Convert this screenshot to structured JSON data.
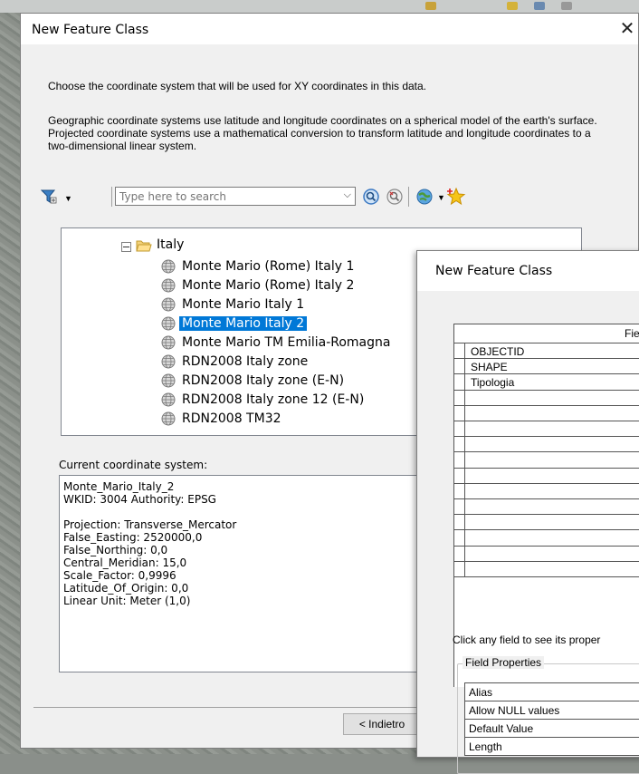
{
  "main_dialog": {
    "title": "New Feature Class",
    "close": "✕",
    "instruction": "Choose the coordinate system that will be used for XY coordinates in this data.",
    "description": "Geographic coordinate systems use latitude and longitude coordinates on a spherical model of the earth's surface. Projected coordinate systems use a mathematical conversion to transform latitude and longitude coordinates to a two-dimensional linear system.",
    "search": {
      "placeholder": "Type here to search"
    },
    "tree": {
      "folder": "Italy",
      "items": [
        "Monte Mario (Rome) Italy 1",
        "Monte Mario (Rome) Italy 2",
        "Monte Mario Italy 1",
        "Monte Mario Italy 2",
        "Monte Mario TM Emilia-Romagna",
        "RDN2008 Italy zone",
        "RDN2008 Italy zone (E-N)",
        "RDN2008 Italy zone 12 (E-N)",
        "RDN2008 TM32"
      ],
      "selected_index": 3
    },
    "current_cs_label": "Current coordinate system:",
    "current_cs_lines": [
      "Monte_Mario_Italy_2",
      "WKID: 3004 Authority: EPSG",
      "",
      "Projection: Transverse_Mercator",
      "False_Easting: 2520000,0",
      "False_Northing: 0,0",
      "Central_Meridian: 15,0",
      "Scale_Factor: 0,9996",
      "Latitude_Of_Origin: 0,0",
      "Linear Unit: Meter (1,0)"
    ],
    "back_button": "< Indietro"
  },
  "second_dialog": {
    "title": "New Feature Class",
    "grid_header": "Field",
    "fields": [
      "OBJECTID",
      "SHAPE",
      "Tipologia"
    ],
    "hint": "Click any field to see its proper",
    "field_properties_label": "Field Properties",
    "properties": [
      "Alias",
      "Allow NULL values",
      "Default Value",
      "Length"
    ]
  },
  "colors": {
    "selection": "#0078d7",
    "dialog_bg": "#f0f0f0"
  }
}
